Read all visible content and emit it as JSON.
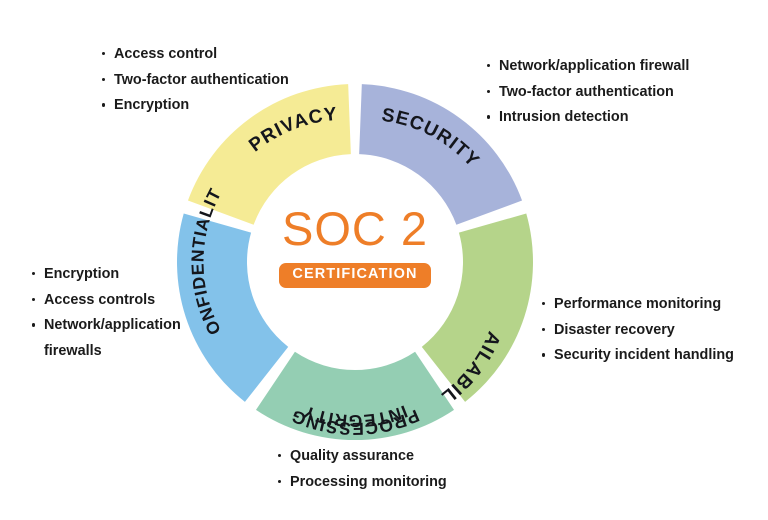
{
  "diagram": {
    "type": "donut",
    "center": {
      "title": "SOC 2",
      "badge": "CERTIFICATION",
      "title_color": "#ee7e28",
      "badge_color": "#ee7e28",
      "badge_text_color": "#ffffff"
    },
    "segments": [
      {
        "key": "security",
        "label": "SECURITY",
        "color": "#a7b3da",
        "start_angle": 0,
        "end_angle": 72,
        "bullets": [
          "Network/application firewall",
          "Two-factor authentication",
          "Intrusion detection"
        ]
      },
      {
        "key": "availability",
        "label": "AVAILABILTY",
        "color": "#b5d48a",
        "start_angle": 72,
        "end_angle": 144,
        "bullets": [
          "Performance monitoring",
          "Disaster recovery",
          "Security incident handling"
        ]
      },
      {
        "key": "processing-integrity",
        "label_line1": "PROCESSING",
        "label_line2": "INTEGRITY",
        "label": "PROCESSING INTEGRITY",
        "color": "#94ceb3",
        "start_angle": 144,
        "end_angle": 216,
        "bullets": [
          "Quality assurance",
          "Processing monitoring"
        ]
      },
      {
        "key": "confidentiality",
        "label": "CONFIDENTIALITY",
        "color": "#83c2ea",
        "start_angle": 216,
        "end_angle": 288,
        "bullets": [
          "Encryption",
          "Access controls",
          "Network/application firewalls"
        ]
      },
      {
        "key": "privacy",
        "label": "PRIVACY",
        "color": "#f5eb95",
        "start_angle": 288,
        "end_angle": 360,
        "bullets": [
          "Access control",
          "Two-factor authentication",
          "Encryption"
        ]
      }
    ],
    "lists": {
      "privacy": [
        "Access control",
        "Two-factor authentication",
        "Encryption"
      ],
      "security": [
        "Network/application firewall",
        "Two-factor authentication",
        "Intrusion detection"
      ],
      "confidentiality": [
        "Encryption",
        "Access controls",
        "Network/application firewalls"
      ],
      "availability": [
        "Performance monitoring",
        "Disaster recovery",
        "Security incident handling"
      ],
      "processing_integrity": [
        "Quality assurance",
        "Processing monitoring"
      ]
    }
  }
}
